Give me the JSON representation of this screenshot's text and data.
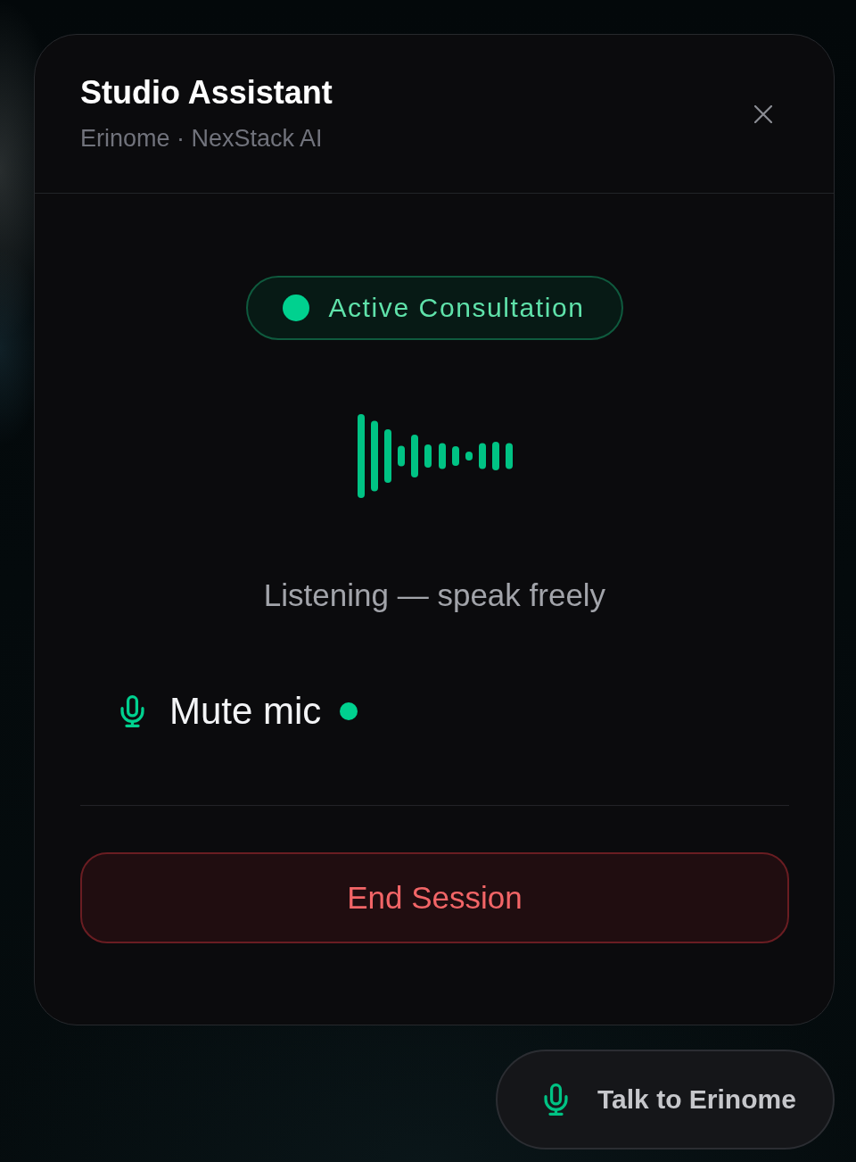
{
  "panel": {
    "title": "Studio Assistant",
    "subtitle": "Erinome · NexStack AI",
    "status_badge": {
      "label": "Active Consultation",
      "active": true
    },
    "status_text": "Listening — speak freely",
    "mic_control": {
      "label": "Mute mic",
      "live": true
    },
    "end_button": {
      "label": "End Session"
    }
  },
  "launcher": {
    "label": "Talk to Erinome"
  }
}
